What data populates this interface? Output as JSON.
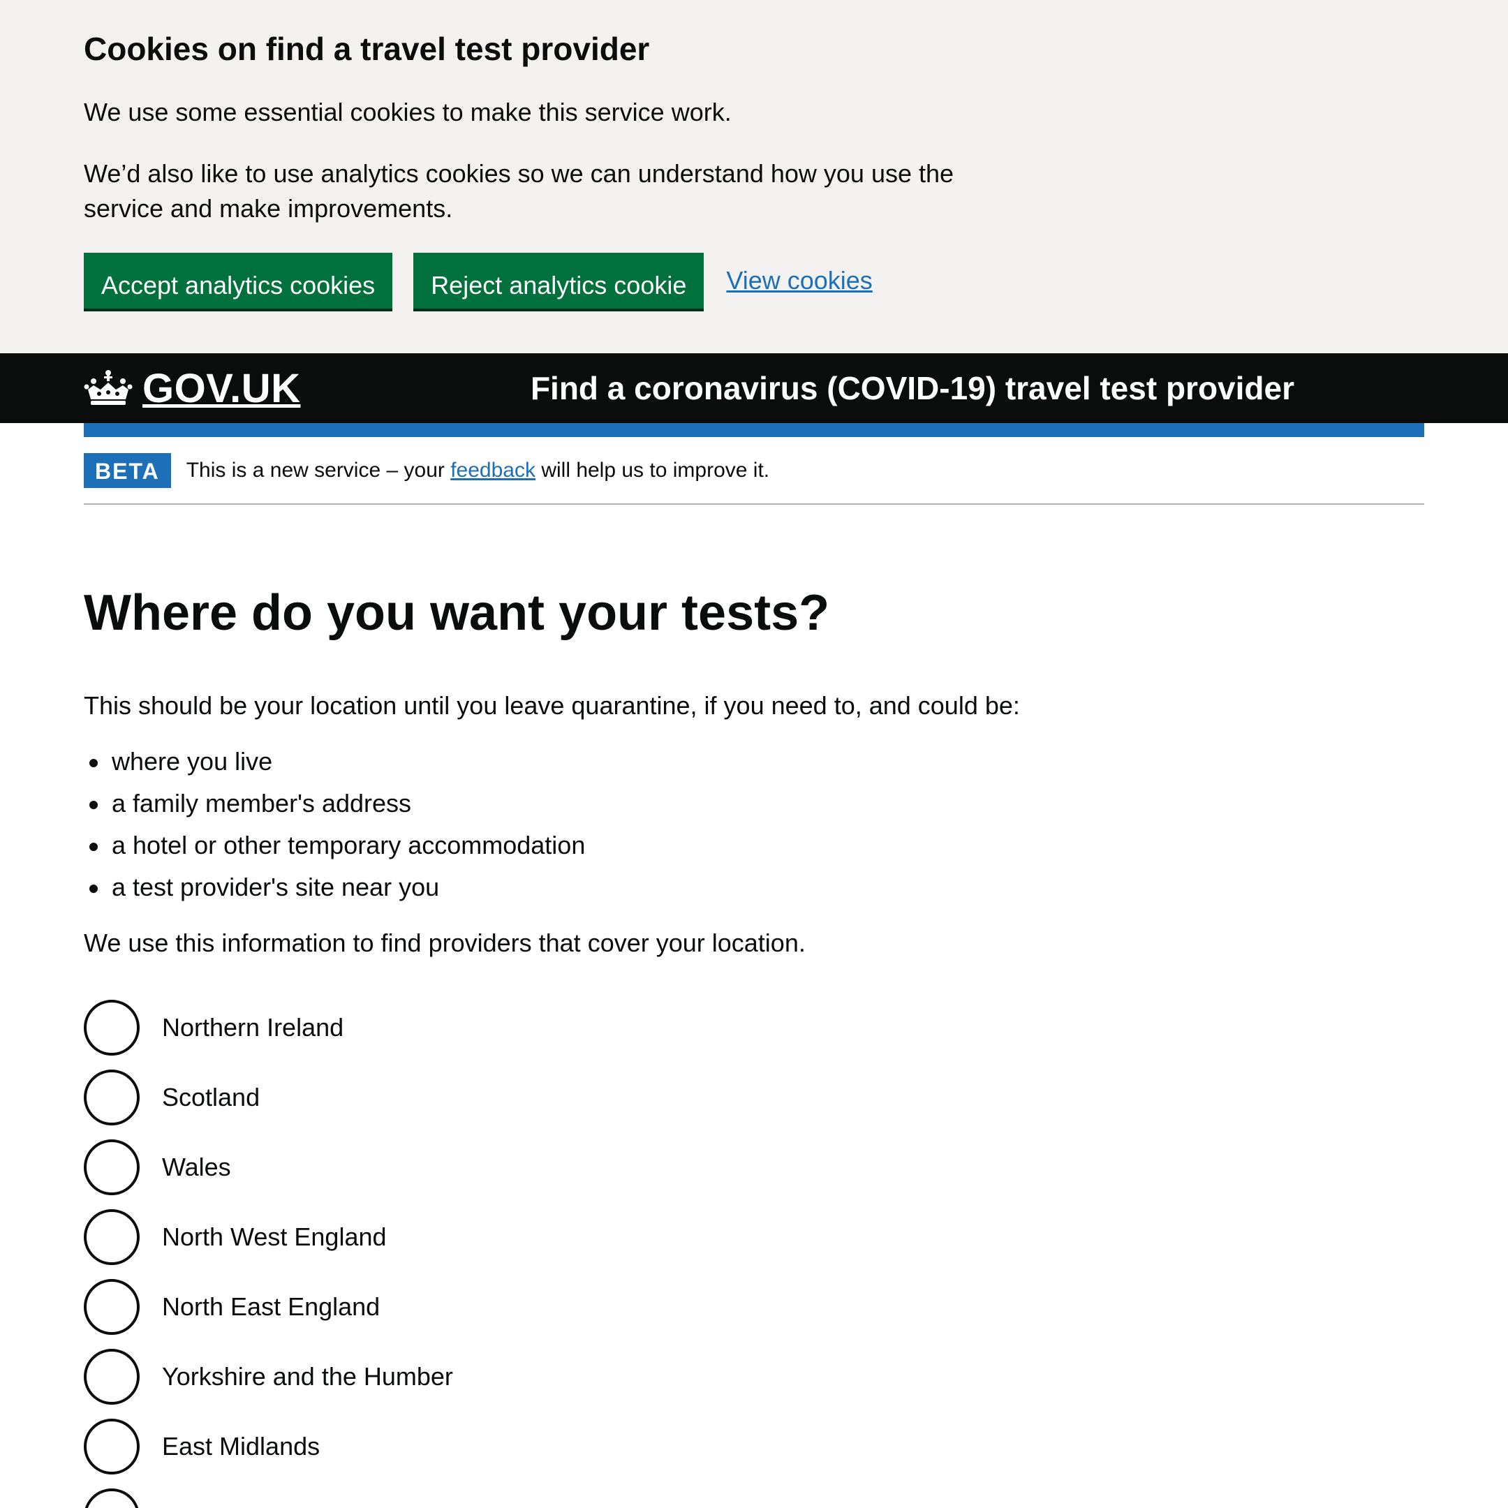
{
  "cookie_banner": {
    "title": "Cookies on find a travel test provider",
    "paragraph_1": "We use some essential cookies to make this service work.",
    "paragraph_2": "We’d also like to use analytics cookies so we can understand how you use the service and make improvements.",
    "accept_label": "Accept analytics cookies",
    "reject_label": "Reject analytics cookie",
    "view_label": "View cookies"
  },
  "header": {
    "logo_text": "GOV.UK",
    "service_name": "Find a coronavirus (COVID-19) travel test provider"
  },
  "phase_banner": {
    "tag": "BETA",
    "text_before": "This is a new service – your ",
    "link_text": "feedback",
    "text_after": " will help us to improve it."
  },
  "main": {
    "title": "Where do you want your tests?",
    "intro": "This should be your location until you leave quarantine, if you need to, and could be:",
    "bullets": [
      "where you live",
      "a family member's address",
      "a hotel or other temporary accommodation",
      "a test provider's site near you"
    ],
    "usage_note": "We use this information to find providers that cover your location.",
    "options": [
      "Northern Ireland",
      "Scotland",
      "Wales",
      "North West England",
      "North East England",
      "Yorkshire and the Humber",
      "East Midlands",
      ""
    ]
  },
  "colors": {
    "button_green": "#00703c",
    "link_blue": "#1d70b8",
    "header_black": "#0b0c0c",
    "banner_grey": "#f3f2f1"
  }
}
